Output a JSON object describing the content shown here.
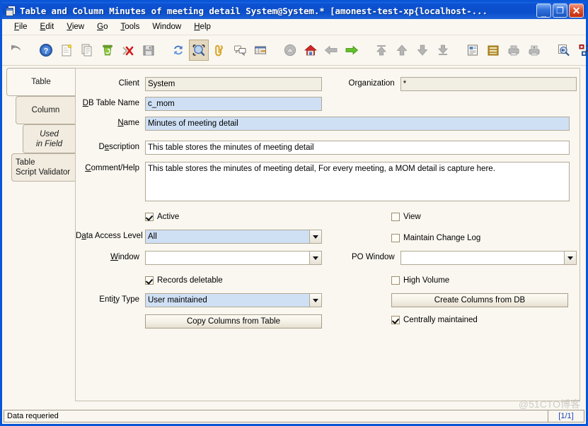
{
  "window": {
    "title": "Table and Column  Minutes of meeting detail  System@System.*  [amonest-test-xp{localhost-...",
    "icon": "table-window-icon",
    "minimize_label": "_",
    "maximize_label": "❐",
    "close_label": "✕"
  },
  "menu": [
    {
      "label": "File",
      "mnemonic": "F"
    },
    {
      "label": "Edit",
      "mnemonic": "E"
    },
    {
      "label": "View",
      "mnemonic": "V"
    },
    {
      "label": "Go",
      "mnemonic": "G"
    },
    {
      "label": "Tools",
      "mnemonic": "T"
    },
    {
      "label": "Window",
      "mnemonic": ""
    },
    {
      "label": "Help",
      "mnemonic": "H"
    }
  ],
  "toolbar": [
    {
      "name": "undo-icon",
      "active": false
    },
    {
      "name": "help-icon",
      "active": false
    },
    {
      "name": "new-record-icon",
      "active": false
    },
    {
      "name": "copy-record-icon",
      "active": false
    },
    {
      "name": "delete-record-icon",
      "active": false
    },
    {
      "name": "delete-selection-icon",
      "active": false
    },
    {
      "name": "save-icon",
      "active": false
    },
    {
      "name": "refresh-icon",
      "active": false
    },
    {
      "name": "zoom-query-icon",
      "active": true
    },
    {
      "name": "attachment-icon",
      "active": false
    },
    {
      "name": "chat-icon",
      "active": false
    },
    {
      "name": "report-grid-icon",
      "active": false
    },
    {
      "name": "parent-record-icon",
      "active": false
    },
    {
      "name": "home-icon",
      "active": false
    },
    {
      "name": "back-arrow-icon",
      "active": false
    },
    {
      "name": "forward-arrow-icon",
      "active": false
    },
    {
      "name": "first-record-icon",
      "active": false
    },
    {
      "name": "previous-record-icon",
      "active": false
    },
    {
      "name": "next-record-icon",
      "active": false
    },
    {
      "name": "last-record-icon",
      "active": false
    },
    {
      "name": "report-icon",
      "active": false
    },
    {
      "name": "archive-icon",
      "active": false
    },
    {
      "name": "print-preview-icon",
      "active": false
    },
    {
      "name": "print-icon",
      "active": false
    },
    {
      "name": "zoom-across-icon",
      "active": false
    },
    {
      "name": "workflow-icon",
      "active": false
    },
    {
      "name": "send-mail-icon",
      "active": false
    }
  ],
  "tabs": [
    {
      "label": "Table",
      "selected": true,
      "italic": false
    },
    {
      "label": "Column",
      "selected": false,
      "italic": false
    },
    {
      "label": "Used\nin Field",
      "line1": "Used",
      "line2": "in Field",
      "selected": false,
      "italic": true
    },
    {
      "label": "Table Script Validator",
      "line1": "Table",
      "line2": "Script Validator",
      "selected": false,
      "italic": false
    }
  ],
  "form": {
    "client": {
      "label": "Client",
      "value": "System",
      "state": "readonly"
    },
    "organization": {
      "label": "Organization",
      "value": "*",
      "state": "readonly"
    },
    "db_table_name": {
      "label": "DB Table Name",
      "mnemonic": "D",
      "value": "c_mom",
      "state": "mandatory"
    },
    "name": {
      "label": "Name",
      "mnemonic": "N",
      "value": "Minutes of meeting detail",
      "state": "mandatory"
    },
    "description": {
      "label": "Description",
      "mnemonic": "e",
      "value": "This table stores the minutes of meeting detail",
      "state": "normal"
    },
    "comment_help": {
      "label": "Comment/Help",
      "mnemonic": "C",
      "value": "This table stores the minutes of meeting detail, For every meeting, a MOM detail is capture here.",
      "state": "normal"
    },
    "active": {
      "label": "Active",
      "checked": true
    },
    "view": {
      "label": "View",
      "checked": false
    },
    "data_access_level": {
      "label": "Data Access Level",
      "mnemonic": "a",
      "value": "All",
      "state": "mandatory"
    },
    "maintain_change_log": {
      "label": "Maintain Change Log",
      "checked": false
    },
    "window": {
      "label": "Window",
      "mnemonic": "W",
      "value": "",
      "state": "normal"
    },
    "po_window": {
      "label": "PO Window",
      "value": "",
      "state": "normal"
    },
    "records_deletable": {
      "label": "Records deletable",
      "checked": true
    },
    "high_volume": {
      "label": "High Volume",
      "checked": false
    },
    "entity_type": {
      "label": "Entity Type",
      "mnemonic": "t",
      "value": "User maintained",
      "state": "mandatory"
    },
    "create_columns_from_db": {
      "label": "Create Columns from DB"
    },
    "copy_columns_from_table": {
      "label": "Copy Columns from Table"
    },
    "centrally_maintained": {
      "label": "Centrally maintained",
      "checked": true
    }
  },
  "statusbar": {
    "message": "Data requeried",
    "record_counter": "[1/1]",
    "watermark": "@51CTO博客"
  },
  "colors": {
    "titlebar_blue": "#0b4ecb",
    "window_border": "#0a56d6",
    "panel_bg": "#faf7f0",
    "mandatory_field": "#cfe0f5",
    "readonly_field": "#f1eee3",
    "field_border": "#b0a896",
    "active_tool_bg": "#e4d8bf",
    "counter_text": "#1a3fc0"
  }
}
